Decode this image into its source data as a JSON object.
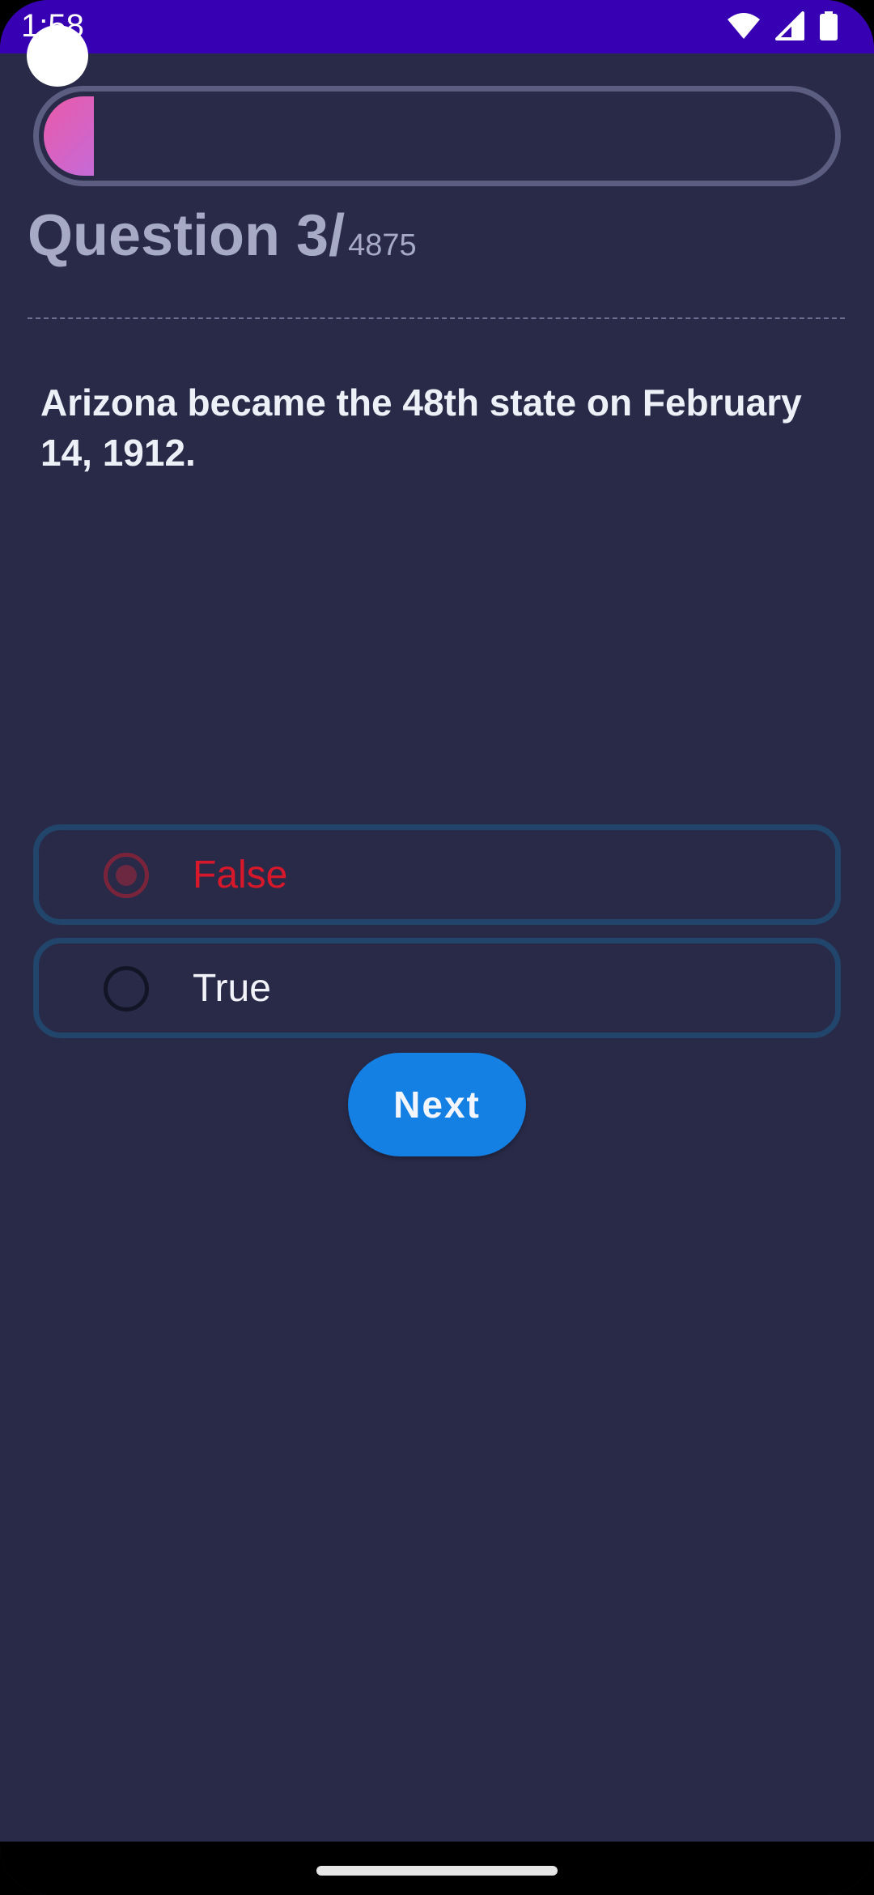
{
  "status_bar": {
    "time": "1:58",
    "icons": [
      "wifi-icon",
      "cellular-signal-icon",
      "battery-icon"
    ],
    "background": "#3700b3"
  },
  "progress": {
    "fraction": 0.0006,
    "gradient": [
      "#ea5aa8",
      "#c66ad8"
    ]
  },
  "question_header": {
    "label": "Question",
    "current": "3",
    "separator": "/",
    "total": "4875"
  },
  "question": {
    "text": "Arizona became the 48th state on February 14, 1912."
  },
  "options": [
    {
      "label": "False",
      "selected": true,
      "color": "#d7172a"
    },
    {
      "label": "True",
      "selected": false,
      "color": "#f2f3f8"
    }
  ],
  "next_button": {
    "label": "Next",
    "color": "#1480e3"
  },
  "theme": {
    "background": "#282a48",
    "option_border": "#22456b"
  }
}
